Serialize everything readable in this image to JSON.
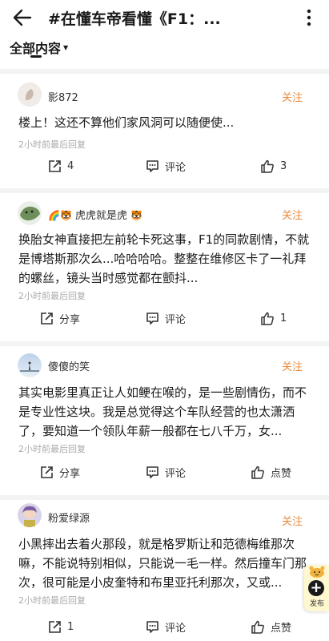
{
  "header": {
    "title": "#在懂车帝看懂《F1：..."
  },
  "filter": {
    "label": "全部内容"
  },
  "cards": [
    {
      "username": "影872",
      "follow": "关注",
      "body": "楼上！这还不算他们家风洞可以随便使...",
      "time": "2小时前最后回复",
      "share_label": "4",
      "comment_label": "评论",
      "like_label": "3"
    },
    {
      "username_prefix": "🌈🐯",
      "username": "虎虎就是虎",
      "username_suffix": "🐯",
      "follow": "关注",
      "body": "换胎女神直接把左前轮卡死这事，F1的同款剧情，不就是博塔斯那次么...哈哈哈哈。整整在维修区卡了一礼拜的螺丝，镜头当时感觉都在颤抖...",
      "time": "2小时前最后回复",
      "share_label": "分享",
      "comment_label": "评论",
      "like_label": "1"
    },
    {
      "username": "傻傻的笑",
      "follow": "关注",
      "body": "其实电影里真正让人如鲠在喉的，是一些剧情伤，而不是专业性这块。我是总觉得这个车队经营的也太潇洒了，要知道一个领队年薪一般都在七八千万，女...",
      "time": "2小时前最后回复",
      "share_label": "分享",
      "comment_label": "评论",
      "like_label": "点赞"
    },
    {
      "username": "粉爱绿源",
      "follow": "关注",
      "body": "小黑摔出去着火那段，就是格罗斯让和范德梅维那次嘛，不能说特别相似，只能说一毛一样。然后撞车门那次，很可能是小皮奎特和布里亚托利那次，又或...",
      "time": "2小时前最后回复",
      "share_label": "1",
      "comment_label": "评论",
      "like_label": "点赞"
    }
  ],
  "fab": {
    "label": "发布"
  },
  "icons": {
    "back": "back-arrow-icon",
    "more": "more-dots-icon",
    "share": "share-icon",
    "comment": "comment-icon",
    "like": "thumbs-up-icon",
    "publish": "plus-icon"
  },
  "colors": {
    "accent": "#e98a3b",
    "text": "#1a1a1a",
    "muted": "#aaaaaa",
    "divider": "#f3f3f3"
  }
}
